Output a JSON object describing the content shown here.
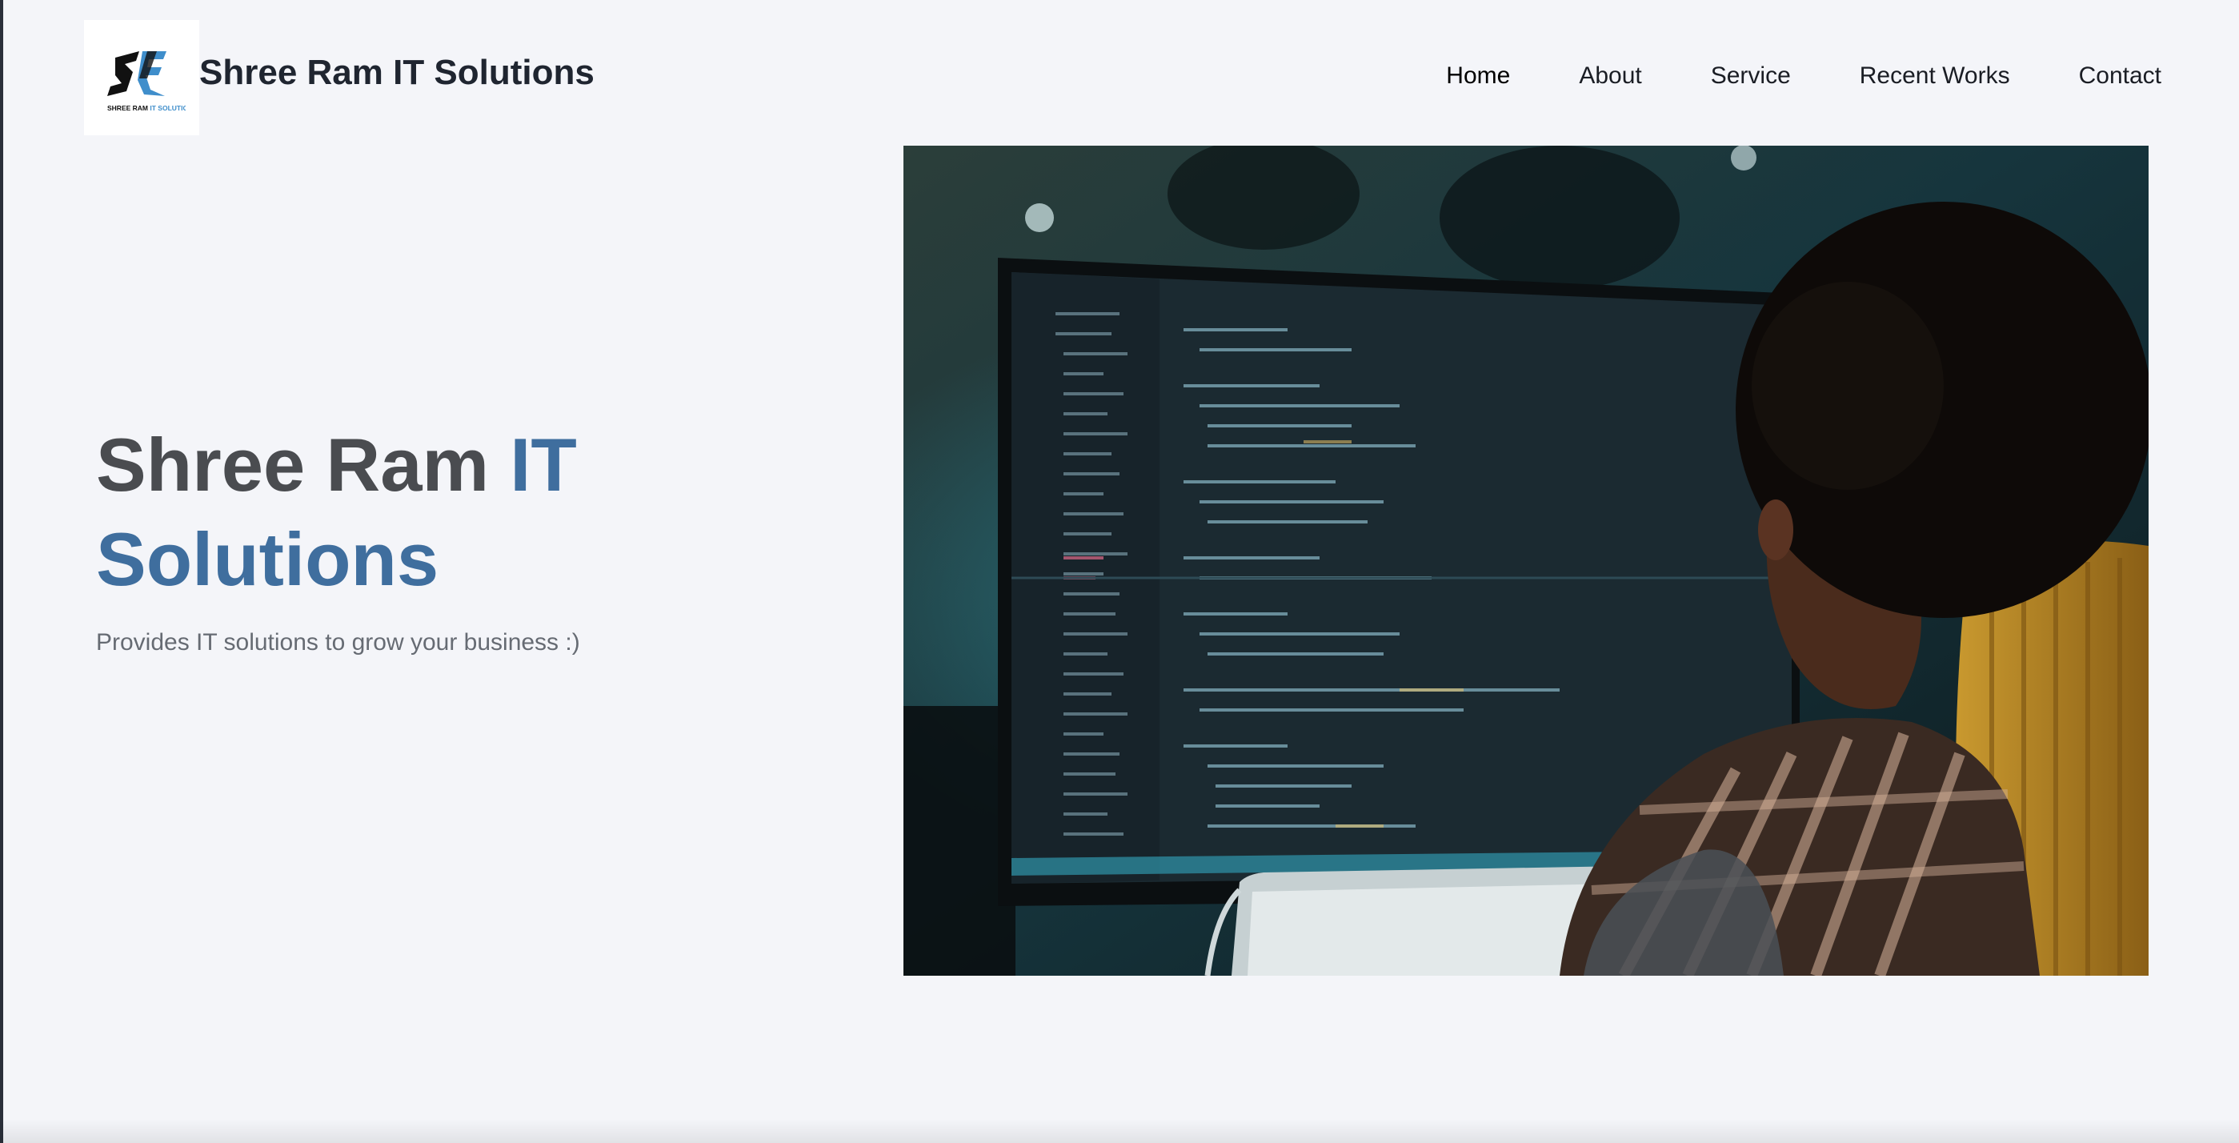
{
  "header": {
    "logo": {
      "icon": "sf-logo",
      "mark_text": "SF",
      "tagline": "SHREE RAM IT SOLUTIONS"
    },
    "brand_name": "Shree Ram IT Solutions"
  },
  "nav": {
    "items": [
      {
        "label": "Home",
        "active": true
      },
      {
        "label": "About",
        "active": false
      },
      {
        "label": "Service",
        "active": false
      },
      {
        "label": "Recent Works",
        "active": false
      },
      {
        "label": "Contact",
        "active": false
      }
    ]
  },
  "hero": {
    "title_part1": "Shree Ram ",
    "title_accent": "IT Solutions",
    "subtitle": "Provides IT solutions to grow your business :)",
    "image": {
      "icon": "developer-at-computer-photo"
    }
  },
  "colors": {
    "background": "#f4f5f9",
    "accent": "#3f6e9e",
    "heading": "#4a4c50",
    "text_muted": "#666b73"
  }
}
